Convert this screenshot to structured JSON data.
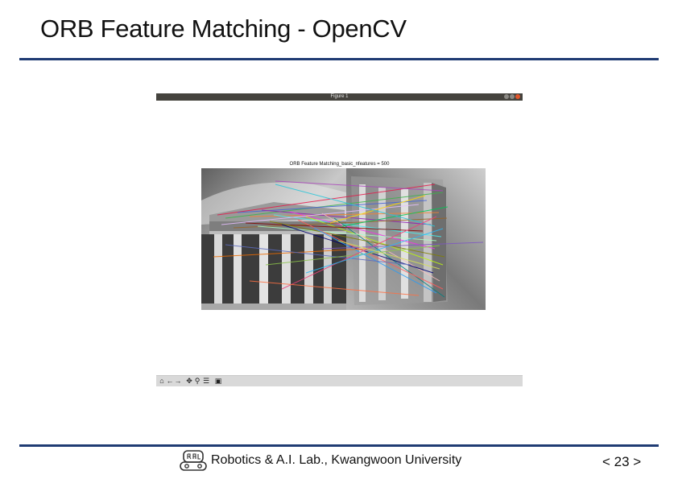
{
  "slide": {
    "title": "ORB Feature Matching - OpenCV",
    "footer": "Robotics & A.I. Lab., Kwangwoon University",
    "page_number": "< 23 >"
  },
  "window": {
    "title": "Figure 1",
    "plot_title": "ORB Feature Matching_basic_nfeatures = 500"
  },
  "toolbar": {
    "buttons": [
      {
        "name": "home-icon",
        "glyph": "⌂"
      },
      {
        "name": "back-icon",
        "glyph": "←"
      },
      {
        "name": "forward-icon",
        "glyph": "→"
      },
      {
        "name": "pan-icon",
        "glyph": "✥"
      },
      {
        "name": "zoom-icon",
        "glyph": "⚲"
      },
      {
        "name": "configure-icon",
        "glyph": "☰"
      },
      {
        "name": "save-icon",
        "glyph": "▣"
      }
    ]
  },
  "colors": {
    "accent_rule": "#1f3b73",
    "window_titlebar": "#45433e",
    "close_button": "#e0552b",
    "toolbar_bg": "#d9d9d9"
  }
}
